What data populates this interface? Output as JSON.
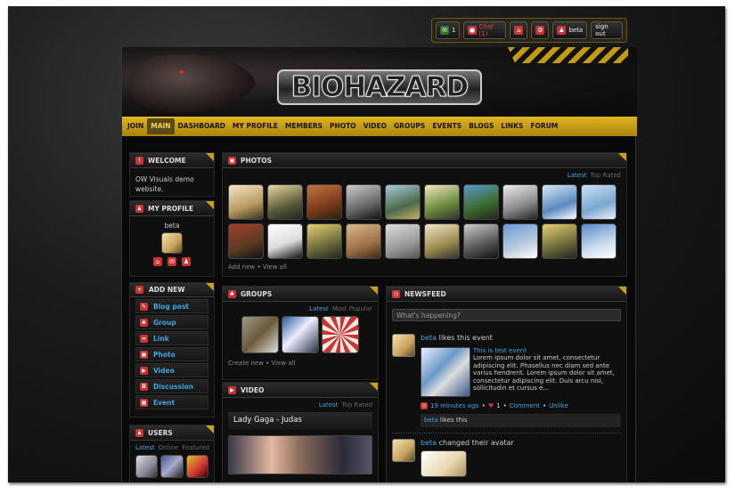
{
  "topbar": {
    "notif_count": "1",
    "chat_label": "Chat (1)",
    "username": "beta",
    "signout": "sign out"
  },
  "logo_text": "BIOHAZARD",
  "nav": [
    "JOIN",
    "MAIN",
    "DASHBOARD",
    "MY PROFILE",
    "MEMBERS",
    "PHOTO",
    "VIDEO",
    "GROUPS",
    "EVENTS",
    "BLOGS",
    "LINKS",
    "FORUM"
  ],
  "welcome": {
    "title": "WELCOME",
    "text": "OW Visuals demo website."
  },
  "profile": {
    "title": "MY PROFILE",
    "name": "beta"
  },
  "addnew": {
    "title": "ADD NEW",
    "items": [
      "Blog post",
      "Group",
      "Link",
      "Photo",
      "Video",
      "Discussion",
      "Event"
    ]
  },
  "users": {
    "title": "USERS",
    "tabs": [
      "Latest",
      "Online",
      "Featured"
    ]
  },
  "photos": {
    "title": "PHOTOS",
    "tab_latest": "Latest",
    "tab_top": "Top Rated",
    "add": "Add new",
    "view": "View all"
  },
  "groups": {
    "title": "GROUPS",
    "tab_latest": "Latest",
    "tab_popular": "Most Popular",
    "create": "Create new",
    "view": "View all"
  },
  "video": {
    "title": "VIDEO",
    "tab_latest": "Latest",
    "tab_top": "Top Rated",
    "item_title": "Lady Gaga - Judas"
  },
  "newsfeed": {
    "title": "NEWSFEED",
    "placeholder": "What's happening?",
    "item1": {
      "user": "beta",
      "action": "likes this event",
      "event": "This is test event",
      "body": "Lorem ipsum dolor sit amet, consectetur adipiscing elit. Phasellus nec diam sed ante varius hendrerit. Lorem ipsum dolor sit amet, consectetur adipiscing elit. Duis arcu nisi, sollicitudin et cursus e...",
      "time": "19 minutes ago",
      "likes": "1",
      "comment": "Comment",
      "unlike": "Unlike",
      "liked_by": "beta",
      "likes_this": "likes this"
    },
    "item2": {
      "user": "beta",
      "action": "changed their avatar"
    }
  },
  "colors": {
    "accent": "#d9ae1c",
    "link": "#3fa4e0",
    "badge": "#cc3333"
  }
}
